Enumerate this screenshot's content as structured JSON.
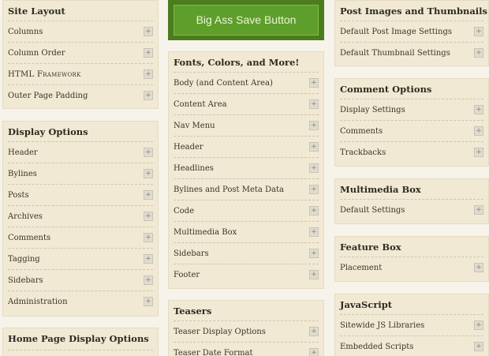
{
  "save_button": {
    "label": "Big Ass Save Button"
  },
  "site_layout": {
    "title": "Site Layout",
    "items": [
      "Columns",
      "Column Order",
      "HTML Framework",
      "Outer Page Padding"
    ]
  },
  "display_options": {
    "title": "Display Options",
    "items": [
      "Header",
      "Bylines",
      "Posts",
      "Archives",
      "Comments",
      "Tagging",
      "Sidebars",
      "Administration"
    ]
  },
  "home_page": {
    "title": "Home Page Display Options"
  },
  "fonts": {
    "title": "Fonts, Colors, and More!",
    "items": [
      "Body (and Content Area)",
      "Content Area",
      "Nav Menu",
      "Header",
      "Headlines",
      "Bylines and Post Meta Data",
      "Code",
      "Multimedia Box",
      "Sidebars",
      "Footer"
    ]
  },
  "teasers": {
    "title": "Teasers",
    "items": [
      "Teaser Display Options",
      "Teaser Date Format"
    ]
  },
  "post_images": {
    "title": "Post Images and Thumbnails",
    "items": [
      "Default Post Image Settings",
      "Default Thumbnail Settings"
    ]
  },
  "comment_options": {
    "title": "Comment Options",
    "items": [
      "Display Settings",
      "Comments",
      "Trackbacks"
    ]
  },
  "multimedia": {
    "title": "Multimedia Box",
    "items": [
      "Default Settings"
    ]
  },
  "feature": {
    "title": "Feature Box",
    "items": [
      "Placement"
    ]
  },
  "javascript": {
    "title": "JavaScript",
    "items": [
      "Sitewide JS Libraries",
      "Embedded Scripts"
    ]
  },
  "expand_glyph": "+"
}
